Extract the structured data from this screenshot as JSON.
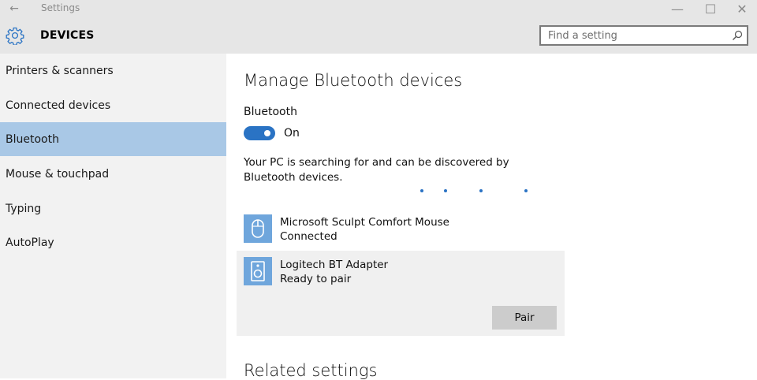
{
  "window": {
    "title": "Settings",
    "back_glyph": "←",
    "minimize_glyph": "—",
    "maximize_glyph": "☐",
    "close_glyph": "✕"
  },
  "header": {
    "icon": "gear-icon",
    "section_title": "DEVICES",
    "search_placeholder": "Find a setting",
    "search_icon": "search-icon"
  },
  "sidebar": {
    "items": [
      {
        "label": "Printers & scanners",
        "active": false
      },
      {
        "label": "Connected devices",
        "active": false
      },
      {
        "label": "Bluetooth",
        "active": true
      },
      {
        "label": "Mouse & touchpad",
        "active": false
      },
      {
        "label": "Typing",
        "active": false
      },
      {
        "label": "AutoPlay",
        "active": false
      }
    ]
  },
  "main": {
    "title": "Manage Bluetooth devices",
    "bluetooth_label": "Bluetooth",
    "toggle_state": "On",
    "toggle_on": true,
    "status_text": "Your PC is searching for and can be discovered by Bluetooth devices.",
    "devices": [
      {
        "name": "Microsoft Sculpt Comfort Mouse",
        "status": "Connected",
        "icon": "mouse-icon"
      },
      {
        "name": "Logitech BT Adapter",
        "status": "Ready to pair",
        "icon": "speaker-icon",
        "action": "Pair"
      }
    ],
    "related_title": "Related settings"
  },
  "colors": {
    "accent": "#2a73c4",
    "selection": "#a9c8e6",
    "device_icon_bg": "#6fa6dc",
    "sidebar_bg": "#f2f2f2",
    "header_bg": "#e6e6e6"
  }
}
